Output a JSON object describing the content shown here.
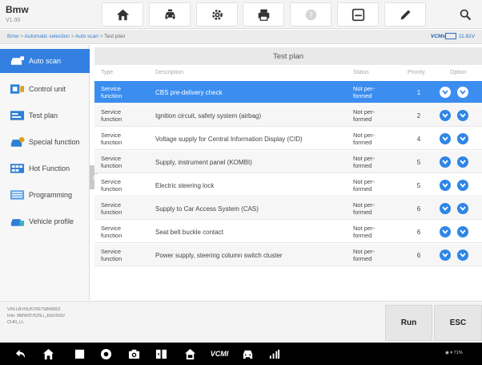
{
  "app": {
    "name": "Bmw",
    "version": "V1.00"
  },
  "toolbar": {
    "icons": [
      "home-icon",
      "car-service-icon",
      "settings-icon",
      "print-icon",
      "help-icon",
      "save-icon",
      "edit-icon",
      "search-icon"
    ]
  },
  "breadcrumb": {
    "parts": [
      "Bmw",
      "Automatic selection",
      "Auto scan",
      "Test plan"
    ],
    "separator": " > ",
    "vci_label": "VCMs",
    "battery": "11.81V"
  },
  "sidebar": {
    "items": [
      {
        "label": "Auto scan",
        "icon": "car-scan-icon",
        "active": true
      },
      {
        "label": "Control unit",
        "icon": "control-unit-icon"
      },
      {
        "label": "Test plan",
        "icon": "test-plan-icon"
      },
      {
        "label": "Special function",
        "icon": "special-function-icon"
      },
      {
        "label": "Hot Function",
        "icon": "hot-function-icon"
      },
      {
        "label": "Programming",
        "icon": "programming-icon"
      },
      {
        "label": "Vehicle profile",
        "icon": "vehicle-profile-icon"
      }
    ]
  },
  "table": {
    "title": "Test plan",
    "headers": {
      "type": "Type",
      "description": "Description",
      "status": "Status",
      "priority": "Priority",
      "option": "Option"
    },
    "rows": [
      {
        "type_1": "Service",
        "type_2": "function",
        "description": "CBS pre-delivery check",
        "status_1": "Not per-",
        "status_2": "formed",
        "priority": "1",
        "selected": true
      },
      {
        "type_1": "Service",
        "type_2": "function",
        "description": "Ignition circuit, safety system (airbag)",
        "status_1": "Not per-",
        "status_2": "formed",
        "priority": "2"
      },
      {
        "type_1": "Service",
        "type_2": "function",
        "description": "Voltage supply for Central Information Display (CID)",
        "status_1": "Not per-",
        "status_2": "formed",
        "priority": "4"
      },
      {
        "type_1": "Service",
        "type_2": "function",
        "description": "Supply, instrument panel (KOMBI)",
        "status_1": "Not per-",
        "status_2": "formed",
        "priority": "5"
      },
      {
        "type_1": "Service",
        "type_2": "function",
        "description": "Electric steering lock",
        "status_1": "Not per-",
        "status_2": "formed",
        "priority": "5"
      },
      {
        "type_1": "Service",
        "type_2": "function",
        "description": "Supply to Car Access System (CAS)",
        "status_1": "Not per-",
        "status_2": "formed",
        "priority": "6"
      },
      {
        "type_1": "Service",
        "type_2": "function",
        "description": "Seat belt buckle contact",
        "status_1": "Not per-",
        "status_2": "formed",
        "priority": "6"
      },
      {
        "type_1": "Service",
        "type_2": "function",
        "description": "Power supply, steering column switch cluster",
        "status_1": "Not per-",
        "status_2": "formed",
        "priority": "6"
      }
    ]
  },
  "vehicle_info": {
    "line1": "VIN:LBVNU57057S849953",
    "line2": "Info: BMW/5'/525Li_E60/S60/",
    "line3": "CHN_LL"
  },
  "actions": {
    "run": "Run",
    "esc": "ESC"
  },
  "colors": {
    "accent": "#3380e0",
    "selected_row": "#3b8ef0",
    "option_button": "#2e86e6"
  },
  "navbar": {
    "icons": [
      "back-icon",
      "home-icon",
      "recent-apps-icon",
      "chrome-icon",
      "camera-icon",
      "split-screen-icon",
      "car-home-icon",
      "vcm-icon",
      "car-icon",
      "signal-icon"
    ],
    "vcm_label": "VCMI",
    "tray": "71%"
  }
}
